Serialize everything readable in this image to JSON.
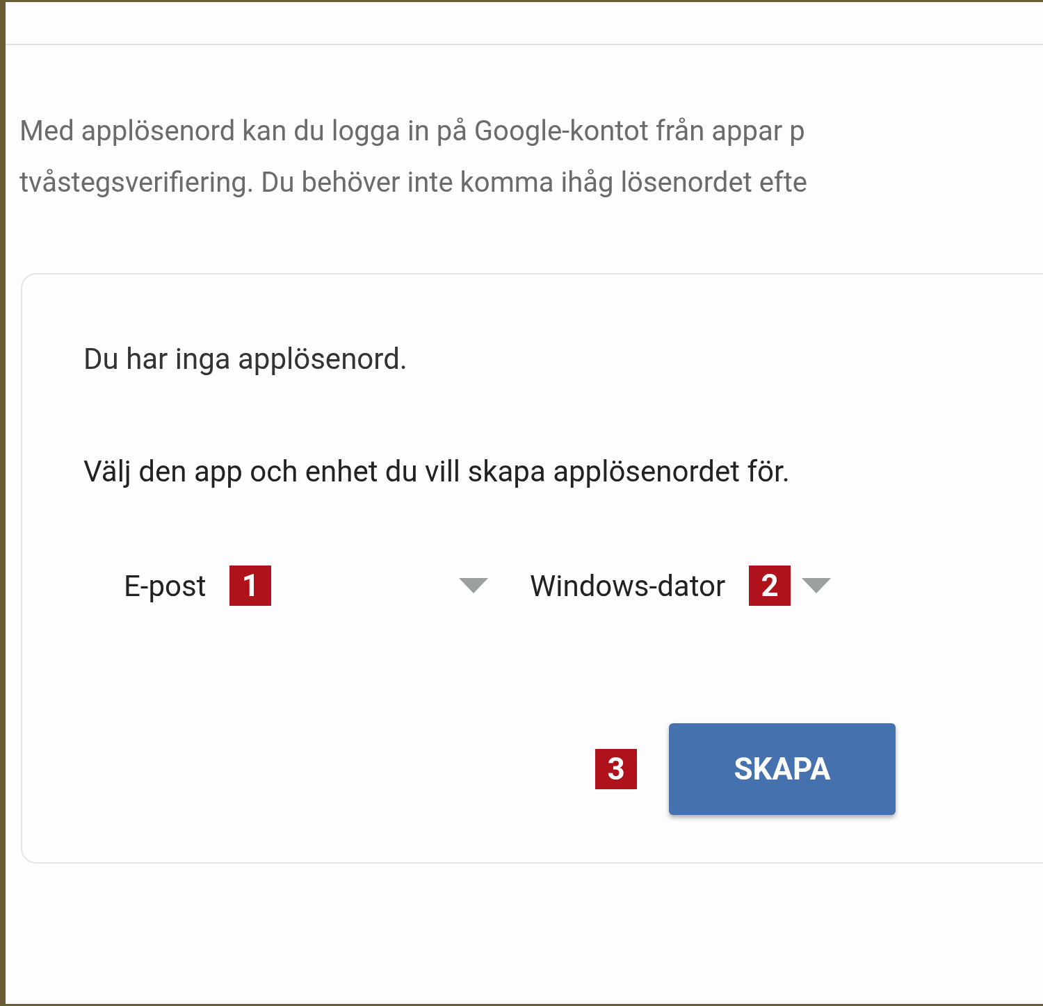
{
  "description_lines": [
    "Med applösenord kan du logga in på Google-kontot från appar p",
    "tvåstegsverifiering. Du behöver inte komma ihåg lösenordet efte"
  ],
  "card": {
    "empty_message": "Du har inga applösenord.",
    "instruction": "Välj den app och enhet du vill skapa applösenordet för.",
    "dropdowns": [
      {
        "value": "E-post",
        "marker": "1"
      },
      {
        "value": "Windows-dator",
        "marker": "2"
      }
    ],
    "create_button": {
      "label": "SKAPA",
      "marker": "3"
    }
  }
}
